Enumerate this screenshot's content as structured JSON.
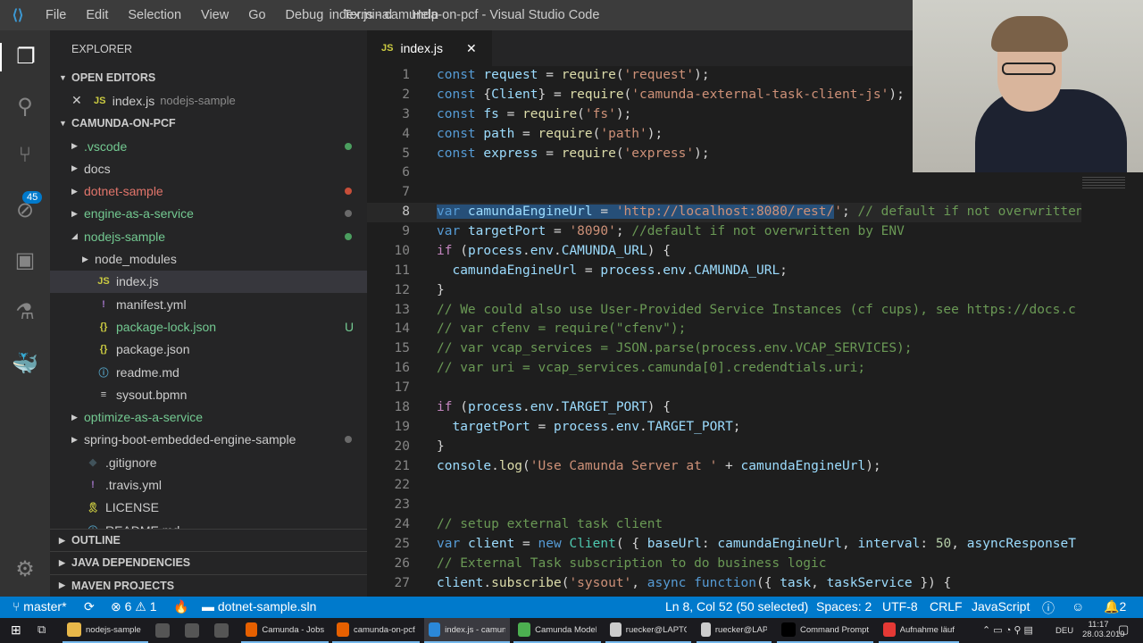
{
  "menu": [
    "File",
    "Edit",
    "Selection",
    "View",
    "Go",
    "Debug",
    "Terminal",
    "Help"
  ],
  "window_title": "index.js - camunda-on-pcf - Visual Studio Code",
  "activity": {
    "scm_badge": "45"
  },
  "sidebar": {
    "title": "EXPLORER",
    "open_editors": "OPEN EDITORS",
    "open_file": {
      "name": "index.js",
      "folder": "nodejs-sample"
    },
    "project": "CAMUNDA-ON-PCF",
    "tree": [
      {
        "name": ".vscode",
        "type": "folder",
        "depth": 0,
        "color": "#73c991",
        "dot": "#4b9e5f"
      },
      {
        "name": "docs",
        "type": "folder",
        "depth": 0,
        "color": "#cccccc"
      },
      {
        "name": "dotnet-sample",
        "type": "folder",
        "depth": 0,
        "color": "#e2756b",
        "dot": "#c74e39"
      },
      {
        "name": "engine-as-a-service",
        "type": "folder",
        "depth": 0,
        "color": "#73c991",
        "dot": "#6a6a6a"
      },
      {
        "name": "nodejs-sample",
        "type": "folder-open",
        "depth": 0,
        "color": "#73c991",
        "dot": "#4b9e5f"
      },
      {
        "name": "node_modules",
        "type": "folder",
        "depth": 1,
        "color": "#cccccc"
      },
      {
        "name": "index.js",
        "type": "js",
        "depth": 1,
        "color": "#cccccc",
        "selected": true
      },
      {
        "name": "manifest.yml",
        "type": "yml",
        "depth": 1,
        "color": "#cccccc"
      },
      {
        "name": "package-lock.json",
        "type": "json",
        "depth": 1,
        "color": "#73c991",
        "flag": "U"
      },
      {
        "name": "package.json",
        "type": "json",
        "depth": 1,
        "color": "#cccccc"
      },
      {
        "name": "readme.md",
        "type": "info",
        "depth": 1,
        "color": "#cccccc"
      },
      {
        "name": "sysout.bpmn",
        "type": "file",
        "depth": 1,
        "color": "#cccccc"
      },
      {
        "name": "optimize-as-a-service",
        "type": "folder",
        "depth": 0,
        "color": "#73c991"
      },
      {
        "name": "spring-boot-embedded-engine-sample",
        "type": "folder",
        "depth": 0,
        "color": "#cccccc",
        "dot": "#6a6a6a"
      },
      {
        "name": ".gitignore",
        "type": "git",
        "depth": 0,
        "color": "#cccccc"
      },
      {
        "name": ".travis.yml",
        "type": "yml",
        "depth": 0,
        "color": "#cccccc"
      },
      {
        "name": "LICENSE",
        "type": "license",
        "depth": 0,
        "color": "#cccccc"
      },
      {
        "name": "README.md",
        "type": "info",
        "depth": 0,
        "color": "#cccccc"
      }
    ],
    "sections": [
      "OUTLINE",
      "JAVA DEPENDENCIES",
      "MAVEN PROJECTS"
    ]
  },
  "tab": {
    "label": "index.js",
    "icon": "JS"
  },
  "code": [
    [
      [
        "k",
        "const"
      ],
      [
        "t",
        " "
      ],
      [
        "v",
        "request"
      ],
      [
        "t",
        " = "
      ],
      [
        "f",
        "require"
      ],
      [
        "t",
        "("
      ],
      [
        "s",
        "'request'"
      ],
      [
        "t",
        ");"
      ]
    ],
    [
      [
        "k",
        "const"
      ],
      [
        "t",
        " {"
      ],
      [
        "v",
        "Client"
      ],
      [
        "t",
        "} = "
      ],
      [
        "f",
        "require"
      ],
      [
        "t",
        "("
      ],
      [
        "s",
        "'camunda-external-task-client-js'"
      ],
      [
        "t",
        ");"
      ]
    ],
    [
      [
        "k",
        "const"
      ],
      [
        "t",
        " "
      ],
      [
        "v",
        "fs"
      ],
      [
        "t",
        " = "
      ],
      [
        "f",
        "require"
      ],
      [
        "t",
        "("
      ],
      [
        "s",
        "'fs'"
      ],
      [
        "t",
        ");"
      ]
    ],
    [
      [
        "k",
        "const"
      ],
      [
        "t",
        " "
      ],
      [
        "v",
        "path"
      ],
      [
        "t",
        " = "
      ],
      [
        "f",
        "require"
      ],
      [
        "t",
        "("
      ],
      [
        "s",
        "'path'"
      ],
      [
        "t",
        ");"
      ]
    ],
    [
      [
        "k",
        "const"
      ],
      [
        "t",
        " "
      ],
      [
        "v",
        "express"
      ],
      [
        "t",
        " = "
      ],
      [
        "f",
        "require"
      ],
      [
        "t",
        "("
      ],
      [
        "s",
        "'express'"
      ],
      [
        "t",
        ");"
      ]
    ],
    [],
    [],
    [
      [
        "k sel",
        "var"
      ],
      [
        "v sel",
        " camundaEngineUrl"
      ],
      [
        "t sel",
        " = "
      ],
      [
        "s sel",
        "'http://localhost:8080/rest/"
      ],
      [
        "s",
        "'"
      ],
      [
        "t",
        "; "
      ],
      [
        "c",
        "// default if not overwritten by ENV"
      ]
    ],
    [
      [
        "k",
        "var"
      ],
      [
        "t",
        " "
      ],
      [
        "v",
        "targetPort"
      ],
      [
        "t",
        " = "
      ],
      [
        "s",
        "'8090'"
      ],
      [
        "t",
        "; "
      ],
      [
        "c",
        "//default if not overwritten by ENV"
      ]
    ],
    [
      [
        "ctl",
        "if"
      ],
      [
        "t",
        " ("
      ],
      [
        "v",
        "process"
      ],
      [
        "t",
        "."
      ],
      [
        "v",
        "env"
      ],
      [
        "t",
        "."
      ],
      [
        "v",
        "CAMUNDA_URL"
      ],
      [
        "t",
        ") {"
      ]
    ],
    [
      [
        "t",
        "  "
      ],
      [
        "v",
        "camundaEngineUrl"
      ],
      [
        "t",
        " = "
      ],
      [
        "v",
        "process"
      ],
      [
        "t",
        "."
      ],
      [
        "v",
        "env"
      ],
      [
        "t",
        "."
      ],
      [
        "v",
        "CAMUNDA_URL"
      ],
      [
        "t",
        ";"
      ]
    ],
    [
      [
        "t",
        "}"
      ]
    ],
    [
      [
        "c",
        "// We could also use User-Provided Service Instances (cf cups), see https://docs.c"
      ]
    ],
    [
      [
        "c",
        "// var cfenv = require(\"cfenv\");"
      ]
    ],
    [
      [
        "c",
        "// var vcap_services = JSON.parse(process.env.VCAP_SERVICES);"
      ]
    ],
    [
      [
        "c",
        "// var uri = vcap_services.camunda[0].credendtials.uri;"
      ]
    ],
    [],
    [
      [
        "ctl",
        "if"
      ],
      [
        "t",
        " ("
      ],
      [
        "v",
        "process"
      ],
      [
        "t",
        "."
      ],
      [
        "v",
        "env"
      ],
      [
        "t",
        "."
      ],
      [
        "v",
        "TARGET_PORT"
      ],
      [
        "t",
        ") {"
      ]
    ],
    [
      [
        "t",
        "  "
      ],
      [
        "v",
        "targetPort"
      ],
      [
        "t",
        " = "
      ],
      [
        "v",
        "process"
      ],
      [
        "t",
        "."
      ],
      [
        "v",
        "env"
      ],
      [
        "t",
        "."
      ],
      [
        "v",
        "TARGET_PORT"
      ],
      [
        "t",
        ";"
      ]
    ],
    [
      [
        "t",
        "}"
      ]
    ],
    [
      [
        "v",
        "console"
      ],
      [
        "t",
        "."
      ],
      [
        "f",
        "log"
      ],
      [
        "t",
        "("
      ],
      [
        "s",
        "'Use Camunda Server at '"
      ],
      [
        "t",
        " + "
      ],
      [
        "v",
        "camundaEngineUrl"
      ],
      [
        "t",
        ");"
      ]
    ],
    [],
    [],
    [
      [
        "c",
        "// setup external task client"
      ]
    ],
    [
      [
        "k",
        "var"
      ],
      [
        "t",
        " "
      ],
      [
        "v",
        "client"
      ],
      [
        "t",
        " = "
      ],
      [
        "k",
        "new"
      ],
      [
        "t",
        " "
      ],
      [
        "cl",
        "Client"
      ],
      [
        "t",
        "( { "
      ],
      [
        "v",
        "baseUrl"
      ],
      [
        "t",
        ": "
      ],
      [
        "v",
        "camundaEngineUrl"
      ],
      [
        "t",
        ", "
      ],
      [
        "v",
        "interval"
      ],
      [
        "t",
        ": "
      ],
      [
        "n",
        "50"
      ],
      [
        "t",
        ", "
      ],
      [
        "v",
        "asyncResponseT"
      ]
    ],
    [
      [
        "c",
        "// External Task subscription to do business logic"
      ]
    ],
    [
      [
        "v",
        "client"
      ],
      [
        "t",
        "."
      ],
      [
        "f",
        "subscribe"
      ],
      [
        "t",
        "("
      ],
      [
        "s",
        "'sysout'"
      ],
      [
        "t",
        ", "
      ],
      [
        "k",
        "async"
      ],
      [
        "t",
        " "
      ],
      [
        "k",
        "function"
      ],
      [
        "t",
        "({ "
      ],
      [
        "v",
        "task"
      ],
      [
        "t",
        ", "
      ],
      [
        "v",
        "taskService"
      ],
      [
        "t",
        " }) {"
      ]
    ]
  ],
  "status": {
    "branch": "master*",
    "errors": "6",
    "warnings": "1",
    "solution": "dotnet-sample.sln",
    "position": "Ln 8, Col 52 (50 selected)",
    "spaces": "Spaces: 2",
    "encoding": "UTF-8",
    "eol": "CRLF",
    "language": "JavaScript",
    "notifications": "2"
  },
  "taskbar": {
    "items": [
      "nodejs-sample",
      "Camunda - Jobs: ...",
      "camunda-on-pcf/...",
      "index.js - camund...",
      "Camunda Modeler",
      "ruecker@LAPTOP...",
      "ruecker@LAPTOP...",
      "Command Prompt",
      "Aufnahme läuft..."
    ],
    "lang": "DEU",
    "time": "11:17",
    "date": "28.03.2019"
  }
}
